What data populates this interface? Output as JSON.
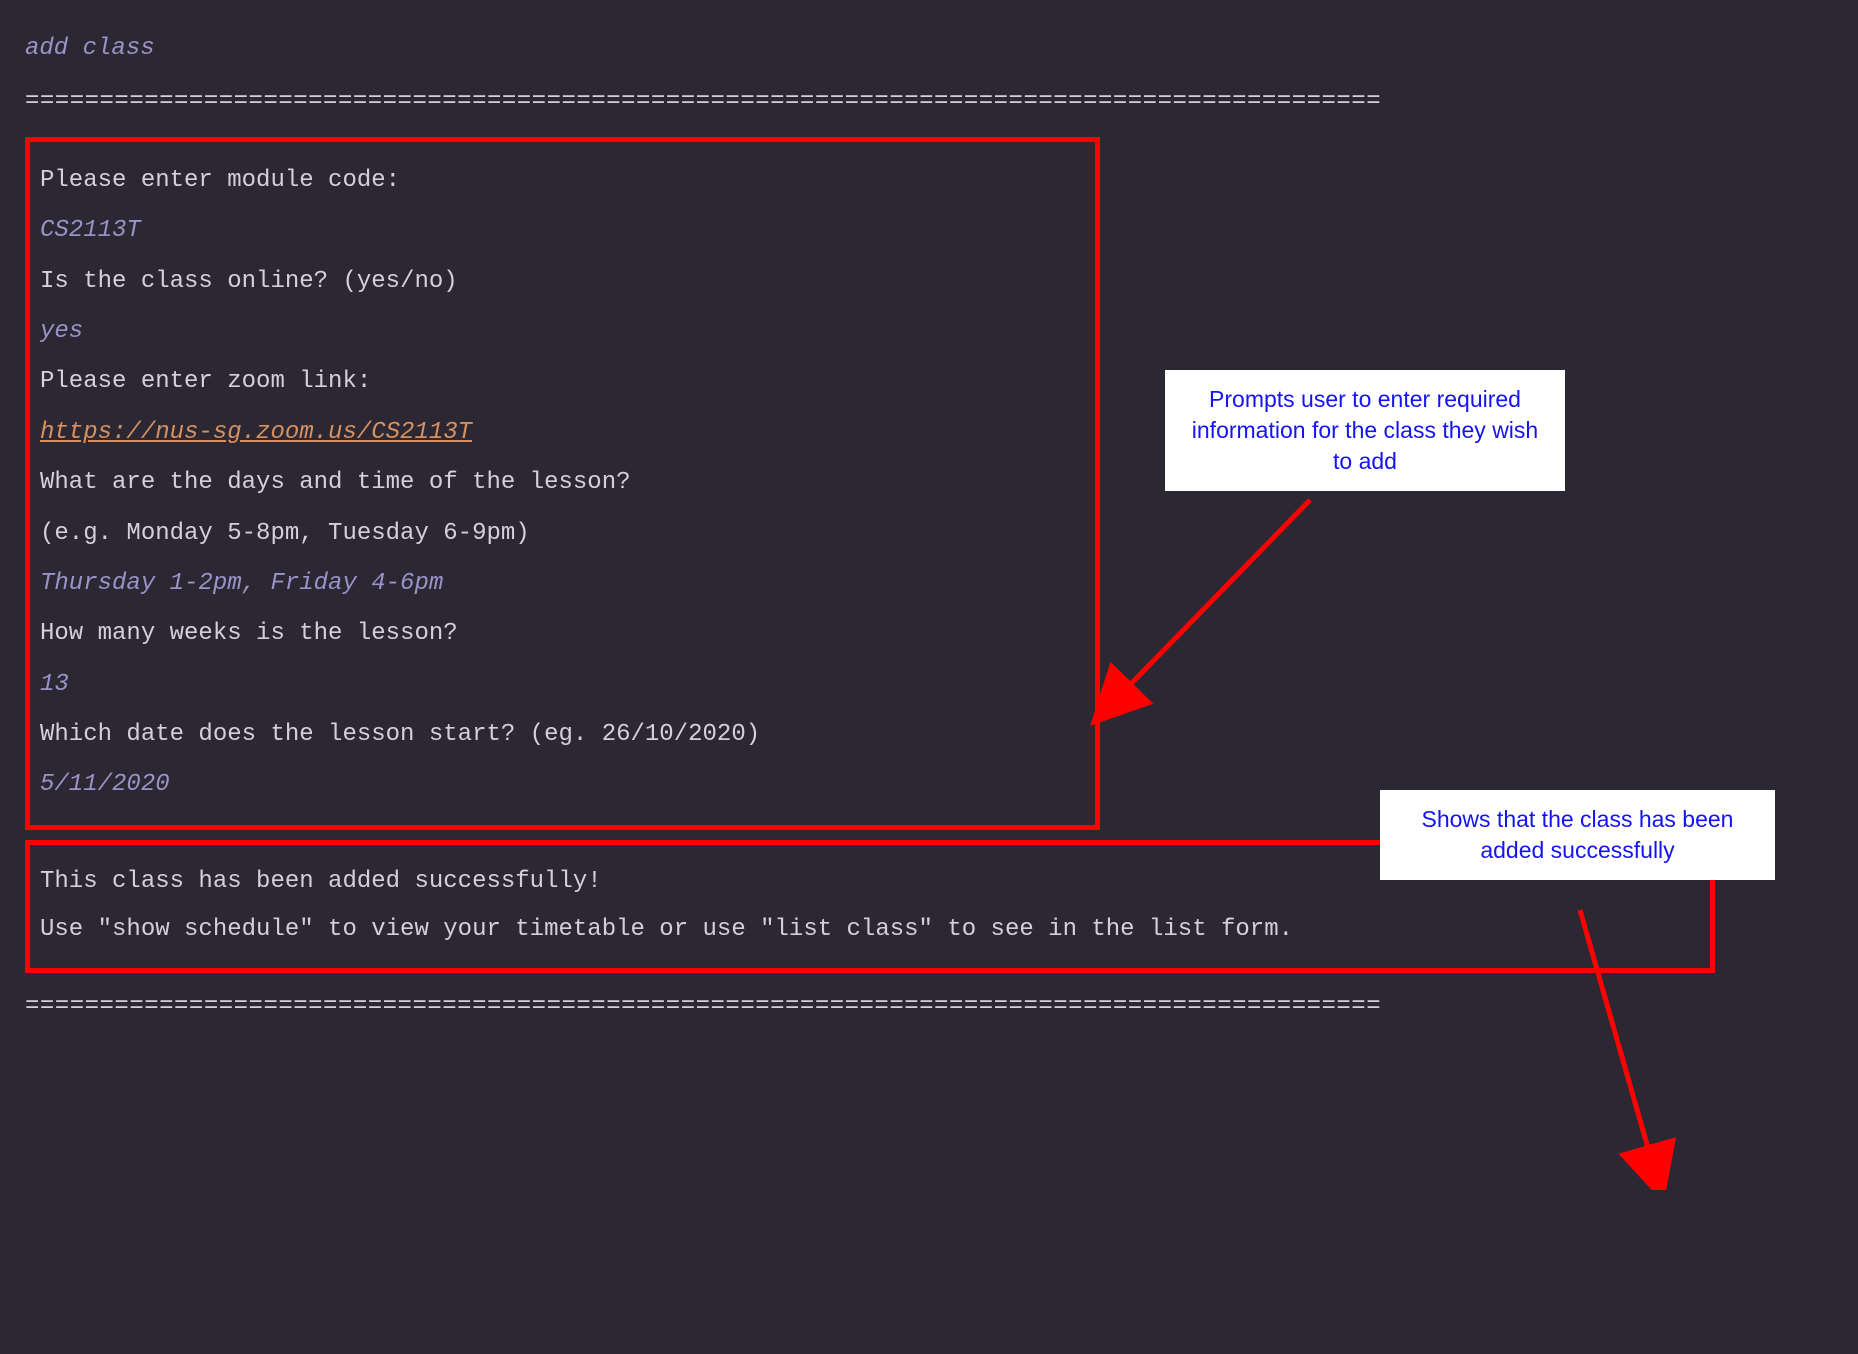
{
  "command": "add class",
  "divider": "===========================================================================================",
  "promptBox": {
    "moduleCodePrompt": "Please enter module code:",
    "moduleCodeInput": "CS2113T",
    "onlinePrompt": "Is the class online? (yes/no)",
    "onlineInput": "yes",
    "zoomPrompt": "Please enter zoom link:",
    "zoomInput": "https://nus-sg.zoom.us/CS2113T",
    "daysPrompt": "What are the days and time of the lesson?",
    "daysExample": "(e.g. Monday 5-8pm, Tuesday 6-9pm)",
    "daysInput": "Thursday 1-2pm, Friday 4-6pm",
    "weeksPrompt": "How many weeks is the lesson?",
    "weeksInput": "13",
    "datePrompt": "Which date does the lesson start? (eg. 26/10/2020)",
    "dateInput": "5/11/2020"
  },
  "successBox": {
    "line1": "This class has been added successfully!",
    "line2": "Use \"show schedule\" to view your timetable or use \"list class\" to see in the list form."
  },
  "callouts": {
    "callout1": "Prompts user to enter required information for the class they wish to add",
    "callout2": "Shows that the class has been added successfully"
  }
}
